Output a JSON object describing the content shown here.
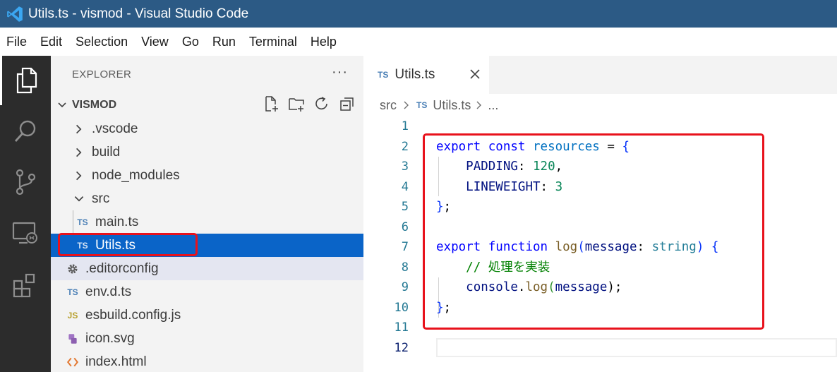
{
  "window": {
    "title": "Utils.ts - vismod - Visual Studio Code"
  },
  "menu": [
    "File",
    "Edit",
    "Selection",
    "View",
    "Go",
    "Run",
    "Terminal",
    "Help"
  ],
  "activity_bar": [
    {
      "name": "explorer-icon",
      "active": true
    },
    {
      "name": "search-icon",
      "active": false
    },
    {
      "name": "source-control-icon",
      "active": false
    },
    {
      "name": "remote-explorer-icon",
      "active": false
    },
    {
      "name": "extensions-icon",
      "active": false
    }
  ],
  "explorer": {
    "title": "EXPLORER",
    "more": "···",
    "section": "VISMOD",
    "actions": [
      "new-file-icon",
      "new-folder-icon",
      "refresh-icon",
      "collapse-all-icon"
    ],
    "items": [
      {
        "label": ".vscode",
        "type": "folder",
        "expanded": false
      },
      {
        "label": "build",
        "type": "folder",
        "expanded": false
      },
      {
        "label": "node_modules",
        "type": "folder",
        "expanded": false
      },
      {
        "label": "src",
        "type": "folder",
        "expanded": true
      },
      {
        "label": "main.ts",
        "type": "ts",
        "badge": "TS"
      },
      {
        "label": "Utils.ts",
        "type": "ts",
        "badge": "TS",
        "selected": true
      },
      {
        "label": ".editorconfig",
        "type": "gear"
      },
      {
        "label": "env.d.ts",
        "type": "ts",
        "badge": "TS"
      },
      {
        "label": "esbuild.config.js",
        "type": "js",
        "badge": "JS"
      },
      {
        "label": "icon.svg",
        "type": "svg"
      },
      {
        "label": "index.html",
        "type": "html",
        "badge": "<>"
      }
    ]
  },
  "tab": {
    "badge": "TS",
    "label": "Utils.ts",
    "close": "×"
  },
  "breadcrumb": {
    "folder": "src",
    "badge": "TS",
    "file": "Utils.ts",
    "rest": "..."
  },
  "editor": {
    "line_numbers": [
      "1",
      "2",
      "3",
      "4",
      "5",
      "6",
      "7",
      "8",
      "9",
      "10",
      "11",
      "12"
    ],
    "current_line": "12",
    "lines": [
      "",
      "export const resources = {",
      "    PADDING: 120,",
      "    LINEWEIGHT: 3",
      "};",
      "",
      "export function log(message: string) {",
      "    // 処理を実装",
      "    console.log(message);",
      "};",
      "",
      ""
    ],
    "tokens": {
      "l2": [
        "export",
        " ",
        "const",
        " ",
        "resources",
        " = ",
        "{"
      ],
      "l3": [
        "PADDING",
        ": ",
        "120",
        ","
      ],
      "l4": [
        "LINEWEIGHT",
        ": ",
        "3"
      ],
      "l5": [
        "}",
        ";"
      ],
      "l7": [
        "export",
        " ",
        "function",
        " ",
        "log",
        "(",
        "message",
        ": ",
        "string",
        ") ",
        "{"
      ],
      "l8": [
        "// 処理を実装"
      ],
      "l9": [
        "console",
        ".",
        "log",
        "(",
        "message",
        ");"
      ],
      "l10": [
        "}",
        ";"
      ]
    }
  },
  "colors": {
    "titlebar": "#2c5a85",
    "activitybar": "#2c2c2c",
    "sidebar": "#f3f3f3",
    "selection": "#0a64c8",
    "highlight_box": "#e8121c",
    "keyword": "#0000ff",
    "number": "#098658",
    "comment": "#008000"
  }
}
